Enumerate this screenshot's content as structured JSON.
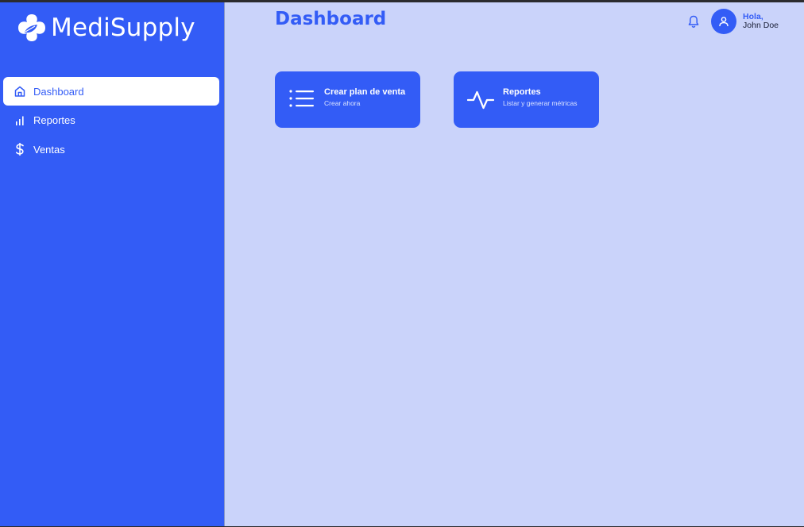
{
  "brand": {
    "name": "MediSupply",
    "logo_icon": "leaf-cross-icon"
  },
  "colors": {
    "primary": "#335cf6",
    "main_background": "#cad3fa",
    "sidebar_background": "#335cf6",
    "active_item_background": "#ffffff"
  },
  "sidebar": {
    "items": [
      {
        "label": "Dashboard",
        "icon": "home-icon",
        "active": true
      },
      {
        "label": "Reportes",
        "icon": "bar-chart-icon",
        "active": false
      },
      {
        "label": "Ventas",
        "icon": "dollar-icon",
        "active": false
      }
    ]
  },
  "header": {
    "title": "Dashboard",
    "notifications_icon": "bell-icon",
    "user_icon": "user-icon",
    "greeting": "Hola,",
    "user_name": "John Doe"
  },
  "cards": [
    {
      "title": "Crear plan de venta",
      "subtitle": "Crear ahora",
      "icon": "list-icon"
    },
    {
      "title": "Reportes",
      "subtitle": "Listar y generar métricas",
      "icon": "activity-icon"
    }
  ]
}
